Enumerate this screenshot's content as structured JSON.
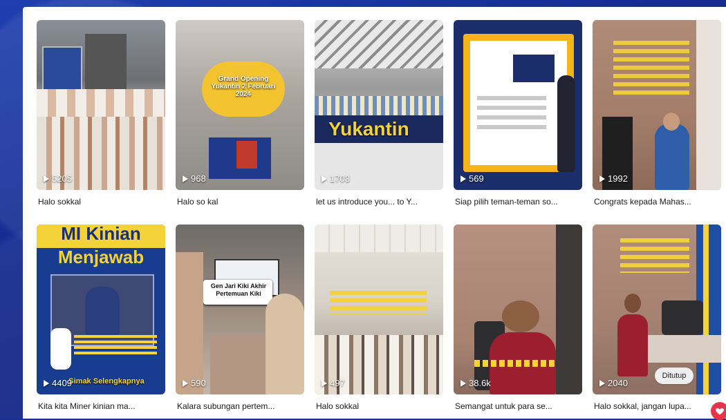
{
  "videos": [
    {
      "views": "5205",
      "caption": "Halo sokkal"
    },
    {
      "views": "968",
      "caption": "Halo so kal"
    },
    {
      "views": "1703",
      "caption": "let us introduce you... to Y..."
    },
    {
      "views": "569",
      "caption": "Siap pilih teman-teman so..."
    },
    {
      "views": "1992",
      "caption": "Congrats kepada Mahas..."
    },
    {
      "views": "4409",
      "caption": "Kita kita Miner kinian ma..."
    },
    {
      "views": "590",
      "caption": "Kalara subungan pertem..."
    },
    {
      "views": "497",
      "caption": "Halo sokkal"
    },
    {
      "views": "38.6k",
      "caption": "Semangat untuk para se..."
    },
    {
      "views": "2040",
      "caption": "Halo sokkal, jangan lupa..."
    }
  ],
  "overlays": {
    "grand_opening": "Grand Opening Yukantin 2 Februari 2024",
    "yukantin_sign": "Yukantin",
    "mi_kinian": "MI Kinian",
    "menjawab": "Menjawab",
    "selengkapnya": "Simak Selengkapnya",
    "dari_kiki": "Gen Jari Kiki Akhir Pertemuan Kiki"
  },
  "controls": {
    "close_label": "Ditutup",
    "fab_icon": "heart-icon"
  },
  "colors": {
    "background": "#14329a",
    "panel": "#ffffff",
    "accent_yellow": "#f3d23a"
  }
}
